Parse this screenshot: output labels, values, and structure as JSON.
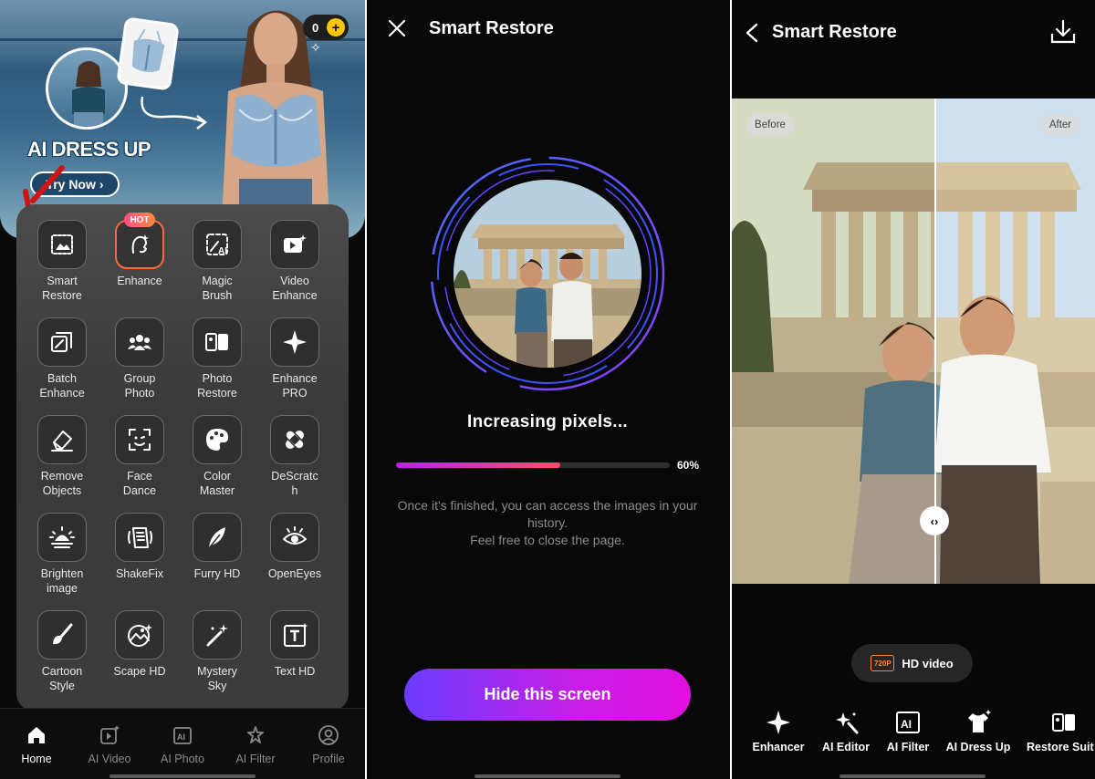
{
  "screen1": {
    "banner": {
      "title": "AI DRESS UP",
      "try_label": "Try Now",
      "coins": "0"
    },
    "hot_badge": "HOT",
    "tools": [
      {
        "label": "Smart\nRestore",
        "icon": "image-restore-icon"
      },
      {
        "label": "Enhance",
        "icon": "enhance-face-icon"
      },
      {
        "label": "Magic\nBrush",
        "icon": "magic-brush-icon"
      },
      {
        "label": "Video\nEnhance",
        "icon": "video-enhance-icon"
      },
      {
        "label": "Batch\nEnhance",
        "icon": "batch-enhance-icon"
      },
      {
        "label": "Group\nPhoto",
        "icon": "group-photo-icon"
      },
      {
        "label": "Photo\nRestore",
        "icon": "photo-restore-icon"
      },
      {
        "label": "Enhance\nPRO",
        "icon": "sparkle-icon"
      },
      {
        "label": "Remove\nObjects",
        "icon": "eraser-icon"
      },
      {
        "label": "Face\nDance",
        "icon": "face-dance-icon"
      },
      {
        "label": "Color\nMaster",
        "icon": "palette-icon"
      },
      {
        "label": "DeScratc\nh",
        "icon": "bandage-icon"
      },
      {
        "label": "Brighten\nimage",
        "icon": "sunrise-icon"
      },
      {
        "label": "ShakeFix",
        "icon": "shake-fix-icon"
      },
      {
        "label": "Furry HD",
        "icon": "feather-icon"
      },
      {
        "label": "OpenEyes",
        "icon": "eye-icon"
      },
      {
        "label": "Cartoon\nStyle",
        "icon": "paintbrush-icon"
      },
      {
        "label": "Scape HD",
        "icon": "landscape-icon"
      },
      {
        "label": "Mystery\nSky",
        "icon": "magic-wand-icon"
      },
      {
        "label": "Text HD",
        "icon": "text-hd-icon"
      }
    ],
    "nav": [
      {
        "label": "Home",
        "icon": "home-icon",
        "active": true
      },
      {
        "label": "AI Video",
        "icon": "ai-video-icon",
        "active": false
      },
      {
        "label": "AI Photo",
        "icon": "ai-photo-icon",
        "active": false
      },
      {
        "label": "AI Filter",
        "icon": "ai-filter-icon",
        "active": false
      },
      {
        "label": "Profile",
        "icon": "profile-icon",
        "active": false
      }
    ]
  },
  "screen2": {
    "title": "Smart Restore",
    "status": "Increasing pixels...",
    "progress": 60,
    "progress_label": "60%",
    "info_line1": "Once it's finished, you can access the images in your history.",
    "info_line2": "Feel free to close the page.",
    "hide_label": "Hide this screen"
  },
  "screen3": {
    "title": "Smart Restore",
    "before_label": "Before",
    "after_label": "After",
    "hd_badge": "720P",
    "hd_label": "HD video",
    "tools": [
      {
        "label": "Enhancer",
        "icon": "sparkle-icon"
      },
      {
        "label": "AI Editor",
        "icon": "ai-editor-icon"
      },
      {
        "label": "AI Filter",
        "icon": "ai-filter-icon"
      },
      {
        "label": "AI Dress Up",
        "icon": "dress-up-icon"
      },
      {
        "label": "Restore Suit",
        "icon": "restore-suit-icon"
      }
    ]
  },
  "colors": {
    "accent_start": "#6b3cff",
    "accent_end": "#e20ee0",
    "progress_start": "#c51bf0",
    "progress_end": "#ff4b6b",
    "hot": "#ff6a3d",
    "coin": "#f6c800"
  }
}
